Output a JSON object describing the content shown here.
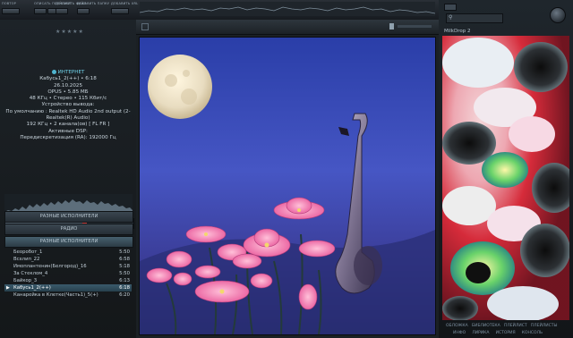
{
  "top_controls": [
    {
      "label": "ПОВТОР",
      "buttons": 1
    },
    {
      "label": "ОПИСАТЬ ПЛЕЙЛИСТ",
      "buttons": 2
    },
    {
      "label": "ДОБАВИТЬ ФАЙЛ",
      "buttons": 2
    },
    {
      "label": "ДОБАВИТЬ ПАПКУ",
      "buttons": 2
    },
    {
      "label": "ДОБАВИТЬ URL",
      "buttons": 1
    }
  ],
  "top_right_label": "ГРОМКОСТЬ",
  "stream": {
    "header": "ИНТЕРНЕТ",
    "track": "Кабусь1_2(++) • 6:18",
    "date": "26.10.2025",
    "codec": "OPUS • 5.85 МБ",
    "format": "48 КГц • Стерео • 115 Кбит/с",
    "device_label": "Устройство вывода:",
    "device": "По умолчанию : Realtek HD Audio 2nd output (2-",
    "device2": "Realtek(R) Audio)",
    "out_format": "192 КГц • 2 канала(ов) [ FL FR ]",
    "dsp": "Активные DSP:",
    "resample": "Передискретизация (RA): 192000 Гц"
  },
  "seek": {
    "progress": 0.62
  },
  "playlist_buttons": [
    "РАЗНЫЕ ИСПОЛНИТЕЛИ",
    "РАДИО",
    "РАЗНЫЕ ИСПОЛНИТЕЛИ"
  ],
  "playlist": [
    {
      "title": "Беоробот_1",
      "duration": "5:50"
    },
    {
      "title": "Всхлип_22",
      "duration": "6:58"
    },
    {
      "title": "Имоплантенин(Белгород)_16",
      "duration": "5:18"
    },
    {
      "title": "За Стеклом_4",
      "duration": "5:50"
    },
    {
      "title": "Байкор_3",
      "duration": "6:13"
    },
    {
      "title": "Кабусь1_2(++)",
      "duration": "6:18",
      "current": true
    },
    {
      "title": "Канарейка в Клетке(Часть1)_5(+)",
      "duration": "6:20"
    }
  ],
  "visualizer": {
    "title": "MilkDrop 2"
  },
  "bottom_tabs_row1": [
    "ОБЛОЖКА",
    "БИБЛИОТЕКА",
    "ПЛЕЙЛИСТ",
    "ПЛЕЙЛИСТЫ"
  ],
  "bottom_tabs_row2": [
    "ИНФО",
    "ЛИРИКА",
    "ИСТОРИЯ",
    "КОНСОЛЬ"
  ],
  "colors": {
    "accent": "#6fd0e6",
    "highlight": "#3a5a6c"
  }
}
